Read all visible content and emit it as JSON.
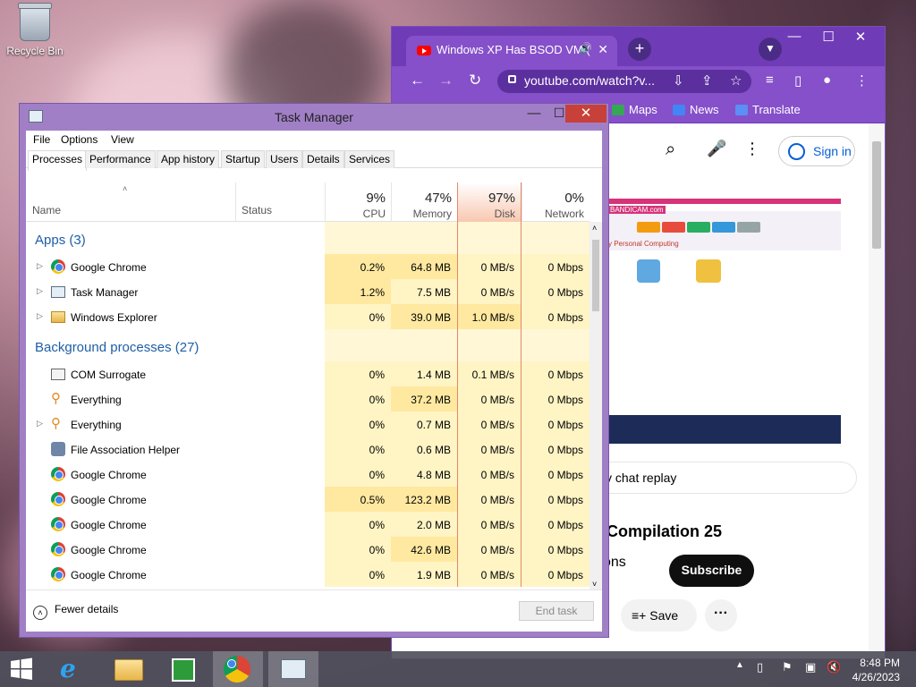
{
  "desktop": {
    "recycle_bin_label": "Recycle Bin"
  },
  "chrome": {
    "tab_title": "Windows XP Has BSOD VM (",
    "url": "youtube.com/watch?v...",
    "bookmarks": [
      "Maps",
      "News",
      "Translate"
    ],
    "signin_label": "Sign in",
    "chat_replay": "v chat replay",
    "video_title": "M Compilation 25",
    "channel_fragment": "ctions",
    "subscribe_label": "Subscribe",
    "save_label": "Save",
    "thumb_brand": "BANDICAM.com",
    "thumb_caption": "y Personal Computing"
  },
  "taskmanager": {
    "title": "Task Manager",
    "menu": [
      "File",
      "Options",
      "View"
    ],
    "tabs": [
      "Processes",
      "Performance",
      "App history",
      "Startup",
      "Users",
      "Details",
      "Services"
    ],
    "columns": {
      "name": "Name",
      "status": "Status",
      "cpu": {
        "pct": "9%",
        "label": "CPU"
      },
      "memory": {
        "pct": "47%",
        "label": "Memory"
      },
      "disk": {
        "pct": "97%",
        "label": "Disk"
      },
      "network": {
        "pct": "0%",
        "label": "Network"
      }
    },
    "groups": [
      {
        "title": "Apps (3)",
        "rows": [
          {
            "name": "Google Chrome",
            "icon": "chrome-icon",
            "expand": true,
            "cpu": "0.2%",
            "memory": "64.8 MB",
            "disk": "0 MB/s",
            "network": "0 Mbps"
          },
          {
            "name": "Task Manager",
            "icon": "task-manager-icon",
            "expand": true,
            "cpu": "1.2%",
            "memory": "7.5 MB",
            "disk": "0 MB/s",
            "network": "0 Mbps"
          },
          {
            "name": "Windows Explorer",
            "icon": "folder-icon",
            "expand": true,
            "cpu": "0%",
            "memory": "39.0 MB",
            "disk": "1.0 MB/s",
            "network": "0 Mbps"
          }
        ]
      },
      {
        "title": "Background processes (27)",
        "rows": [
          {
            "name": "COM Surrogate",
            "icon": "window-icon",
            "expand": false,
            "cpu": "0%",
            "memory": "1.4 MB",
            "disk": "0.1 MB/s",
            "network": "0 Mbps"
          },
          {
            "name": "Everything",
            "icon": "search-icon",
            "expand": false,
            "cpu": "0%",
            "memory": "37.2 MB",
            "disk": "0 MB/s",
            "network": "0 Mbps"
          },
          {
            "name": "Everything",
            "icon": "search-icon",
            "expand": true,
            "cpu": "0%",
            "memory": "0.7 MB",
            "disk": "0 MB/s",
            "network": "0 Mbps"
          },
          {
            "name": "File Association Helper",
            "icon": "gear-icon",
            "expand": false,
            "cpu": "0%",
            "memory": "0.6 MB",
            "disk": "0 MB/s",
            "network": "0 Mbps"
          },
          {
            "name": "Google Chrome",
            "icon": "chrome-icon",
            "expand": false,
            "cpu": "0%",
            "memory": "4.8 MB",
            "disk": "0 MB/s",
            "network": "0 Mbps"
          },
          {
            "name": "Google Chrome",
            "icon": "chrome-icon",
            "expand": false,
            "cpu": "0.5%",
            "memory": "123.2 MB",
            "disk": "0 MB/s",
            "network": "0 Mbps"
          },
          {
            "name": "Google Chrome",
            "icon": "chrome-icon",
            "expand": false,
            "cpu": "0%",
            "memory": "2.0 MB",
            "disk": "0 MB/s",
            "network": "0 Mbps"
          },
          {
            "name": "Google Chrome",
            "icon": "chrome-icon",
            "expand": false,
            "cpu": "0%",
            "memory": "42.6 MB",
            "disk": "0 MB/s",
            "network": "0 Mbps"
          },
          {
            "name": "Google Chrome",
            "icon": "chrome-icon",
            "expand": false,
            "cpu": "0%",
            "memory": "1.9 MB",
            "disk": "0 MB/s",
            "network": "0 Mbps"
          }
        ]
      }
    ],
    "fewer_details": "Fewer details",
    "end_task": "End task"
  },
  "taskbar": {
    "items": [
      "start-icon",
      "internet-explorer-icon",
      "file-explorer-icon",
      "store-icon",
      "chrome-icon",
      "task-manager-icon"
    ],
    "time": "8:48 PM",
    "date": "4/26/2023"
  },
  "colors": {
    "chrome_frame": "#8550c9",
    "taskmanager_frame": "#a17fc6",
    "disk_highlight": "#f8c8b0",
    "heat_light": "#fff4c4",
    "heat_medium": "#ffe9a0",
    "link_blue": "#1d5fa6"
  }
}
